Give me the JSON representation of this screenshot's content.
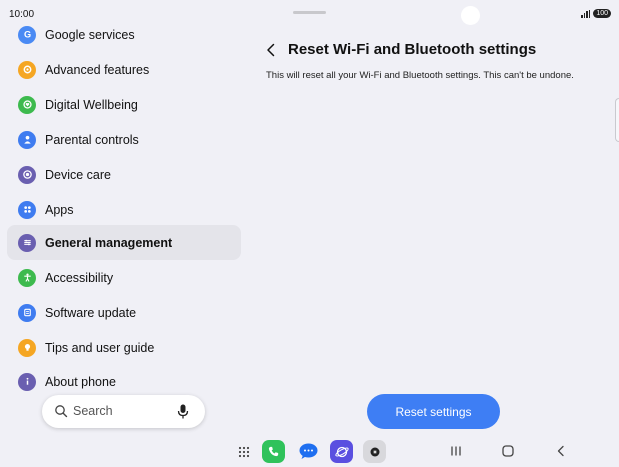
{
  "status_bar": {
    "time": "10:00",
    "battery": "100"
  },
  "sidebar": {
    "items": [
      {
        "label": "Google services",
        "icon": "google-icon",
        "color": "#4a8af4"
      },
      {
        "label": "Advanced features",
        "icon": "gear-plus-icon",
        "color": "#f5a623"
      },
      {
        "label": "Digital Wellbeing",
        "icon": "heart-icon",
        "color": "#3dba4e"
      },
      {
        "label": "Parental controls",
        "icon": "person-icon",
        "color": "#3f7cf0"
      },
      {
        "label": "Device care",
        "icon": "device-care-icon",
        "color": "#6a5fb0"
      },
      {
        "label": "Apps",
        "icon": "apps-grid-icon",
        "color": "#3f7cf0"
      },
      {
        "label": "General management",
        "icon": "sliders-icon",
        "color": "#6a5fb0",
        "selected": true
      },
      {
        "label": "Accessibility",
        "icon": "accessibility-icon",
        "color": "#3dba4e"
      },
      {
        "label": "Software update",
        "icon": "software-update-icon",
        "color": "#3f7cf0"
      },
      {
        "label": "Tips and user guide",
        "icon": "lightbulb-icon",
        "color": "#f5a623"
      },
      {
        "label": "About phone",
        "icon": "info-icon",
        "color": "#6a5fb0"
      }
    ]
  },
  "search": {
    "placeholder": "Search"
  },
  "main": {
    "title": "Reset Wi-Fi and Bluetooth settings",
    "description": "This will reset all your Wi-Fi and Bluetooth settings. This can't be undone.",
    "reset_button_label": "Reset settings"
  },
  "colors": {
    "accent": "#3e7ef4",
    "background": "#f0f0f6",
    "selected": "#e4e4ea"
  },
  "taskbar": {
    "apps": [
      {
        "name": "apps-drawer-icon"
      },
      {
        "name": "phone-app-icon",
        "color": "#2fc25b"
      },
      {
        "name": "messages-app-icon",
        "color": "#1f6ff0"
      },
      {
        "name": "internet-app-icon",
        "color": "#5a4fe0"
      },
      {
        "name": "camera-app-icon",
        "color": "#d8d8dc"
      }
    ],
    "nav": [
      "recents-button",
      "home-button",
      "back-nav-button"
    ]
  }
}
